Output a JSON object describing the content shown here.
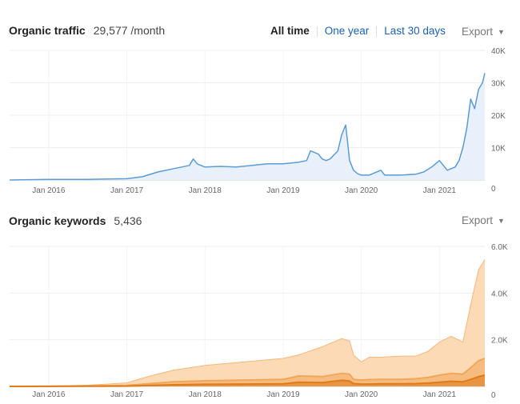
{
  "traffic": {
    "title": "Organic traffic",
    "value": "29,577 /month",
    "ranges": [
      "All time",
      "One year",
      "Last 30 days"
    ],
    "export_label": "Export",
    "caret_icon": "caret-down-icon"
  },
  "keywords": {
    "title": "Organic keywords",
    "value": "5,436",
    "export_label": "Export",
    "caret_icon": "caret-down-icon"
  },
  "chart_data": [
    {
      "type": "area",
      "title": "",
      "xlabel": "",
      "ylabel": "",
      "x_ticks": [
        "Jan 2016",
        "Jan 2017",
        "Jan 2018",
        "Jan 2019",
        "Jan 2020",
        "Jan 2021"
      ],
      "y_ticks": [
        "0",
        "10K",
        "20K",
        "30K",
        "40K"
      ],
      "xlim": [
        2015.5,
        2021.58
      ],
      "ylim": [
        0,
        40000
      ],
      "grid": true,
      "color": "#5b9bd5",
      "fill": "#e8f1fb",
      "series": [
        {
          "x": [
            2015.5,
            2016.0,
            2016.5,
            2017.0,
            2017.2,
            2017.4,
            2017.6,
            2017.8,
            2017.85,
            2017.9,
            2018.0,
            2018.2,
            2018.4,
            2018.6,
            2018.8,
            2019.0,
            2019.2,
            2019.3,
            2019.35,
            2019.45,
            2019.5,
            2019.55,
            2019.6,
            2019.7,
            2019.75,
            2019.8,
            2019.85,
            2019.9,
            2019.95,
            2020.0,
            2020.1,
            2020.25,
            2020.3,
            2020.5,
            2020.7,
            2020.8,
            2020.9,
            2021.0,
            2021.1,
            2021.2,
            2021.25,
            2021.3,
            2021.35,
            2021.4,
            2021.45,
            2021.5,
            2021.55,
            2021.58
          ],
          "y": [
            0,
            200,
            200,
            400,
            1000,
            2500,
            3500,
            4500,
            6500,
            5000,
            4000,
            4200,
            4000,
            4500,
            5000,
            5000,
            5500,
            6000,
            9000,
            8000,
            6500,
            6000,
            6500,
            9000,
            14000,
            17000,
            6000,
            3000,
            2000,
            1500,
            1500,
            3000,
            1500,
            1500,
            1800,
            2500,
            4000,
            6000,
            3000,
            4000,
            6000,
            10000,
            16000,
            25000,
            22000,
            28000,
            30000,
            33000
          ]
        }
      ]
    },
    {
      "type": "area",
      "title": "",
      "xlabel": "",
      "ylabel": "",
      "x_ticks": [
        "Jan 2016",
        "Jan 2017",
        "Jan 2018",
        "Jan 2019",
        "Jan 2020",
        "Jan 2021"
      ],
      "y_ticks": [
        "0",
        "2.0K",
        "4.0K",
        "6.0K"
      ],
      "xlim": [
        2015.5,
        2021.58
      ],
      "ylim": [
        0,
        6000
      ],
      "grid": true,
      "x": [
        2015.5,
        2016.0,
        2016.5,
        2017.0,
        2017.3,
        2017.6,
        2018.0,
        2018.5,
        2019.0,
        2019.2,
        2019.5,
        2019.75,
        2019.85,
        2019.9,
        2020.0,
        2020.1,
        2020.25,
        2020.5,
        2020.7,
        2020.85,
        2021.0,
        2021.15,
        2021.3,
        2021.4,
        2021.5,
        2021.58
      ],
      "series": [
        {
          "color": "#fbd3a8",
          "y": [
            0,
            10,
            50,
            150,
            450,
            700,
            900,
            1050,
            1200,
            1350,
            1700,
            2050,
            1950,
            1350,
            1050,
            1250,
            1250,
            1300,
            1300,
            1500,
            1900,
            2150,
            1900,
            3500,
            5000,
            5436
          ]
        },
        {
          "color": "#f2a65a",
          "y": [
            0,
            5,
            20,
            40,
            120,
            200,
            240,
            270,
            300,
            450,
            420,
            560,
            520,
            300,
            270,
            290,
            300,
            300,
            330,
            380,
            480,
            560,
            520,
            800,
            1100,
            1200
          ]
        },
        {
          "color": "#e07b1a",
          "y": [
            0,
            2,
            8,
            15,
            40,
            70,
            90,
            100,
            110,
            180,
            160,
            260,
            230,
            120,
            100,
            100,
            110,
            110,
            120,
            140,
            180,
            220,
            200,
            300,
            420,
            480
          ]
        }
      ]
    }
  ]
}
